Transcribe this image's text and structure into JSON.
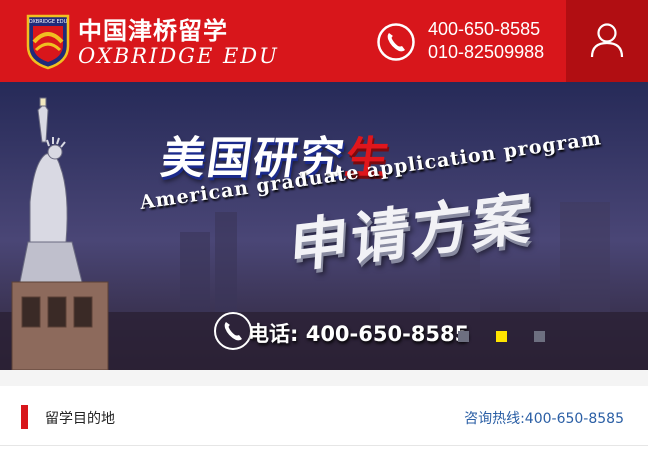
{
  "header": {
    "brand_cn": "中国津桥留学",
    "brand_en": "OXBRIDGE EDU",
    "logo_text": "OXBRIDGE EDU",
    "phone_1": "400-650-8585",
    "phone_2": "010-82509988",
    "icons": {
      "phone": "phone-icon",
      "user": "user-icon"
    },
    "colors": {
      "header_bg": "#d8161b",
      "user_box_bg": "#b10e12"
    }
  },
  "banner": {
    "title_cn_part": "美国研究",
    "title_cn_red": "生",
    "title_en": "American graduate application program",
    "title_big": "申请方案",
    "tel_text": "电话: 400-650-8585",
    "slides": 3,
    "active_slide": 2,
    "colors": {
      "active_dot": "#ffe400",
      "dot": "#6d6f80"
    }
  },
  "section": {
    "title": "留学目的地",
    "hotline": "咨询热线:400-650-8585",
    "colors": {
      "marker": "#d8161b",
      "hotline": "#2b5fa5"
    }
  }
}
